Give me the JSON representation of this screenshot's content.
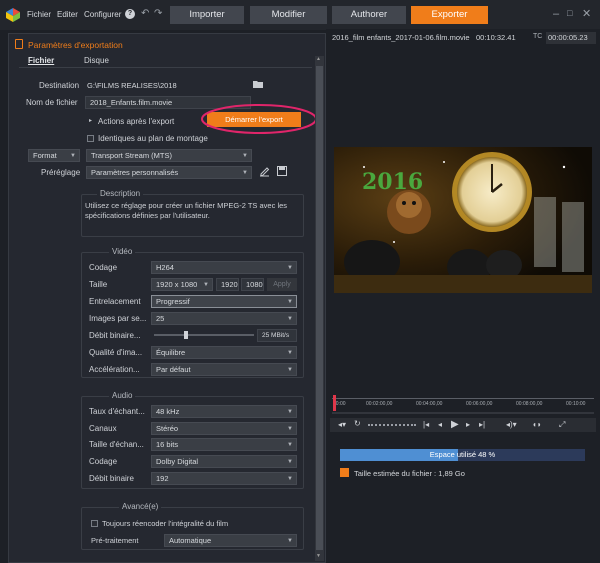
{
  "menu": {
    "file": "Fichier",
    "edit": "Editer",
    "configure": "Configurer",
    "help_icon": "?"
  },
  "main_tabs": {
    "import": "Importer",
    "modify": "Modifier",
    "author": "Authorer",
    "export": "Exporter"
  },
  "panel_title": "Paramètres d'exportation",
  "sub_tabs": {
    "file": "Fichier",
    "disc": "Disque"
  },
  "destination": {
    "label": "Destination",
    "value": "G:\\FILMS REALISES\\2018"
  },
  "filename": {
    "label": "Nom de fichier",
    "value": "2018_Enfants.film.movie"
  },
  "actions_after": "Actions après l'export",
  "start_export": "Démarrer l'export",
  "same_as_timeline": "Identiques au plan de montage",
  "format": {
    "label": "Format",
    "value": "Transport Stream (MTS)"
  },
  "preset": {
    "label": "Préréglage",
    "value": "Paramètres personnalisés"
  },
  "description": {
    "title": "Description",
    "text": "Utilisez ce réglage pour créer un fichier MPEG-2 TS avec les spécifications définies par l'utilisateur."
  },
  "video": {
    "title": "Vidéo",
    "codec": {
      "label": "Codage",
      "value": "H264"
    },
    "size": {
      "label": "Taille",
      "value": "1920 x 1080",
      "width": "1920",
      "height": "1080",
      "apply": "Apply"
    },
    "interlace": {
      "label": "Entrelacement",
      "value": "Progressif"
    },
    "fps": {
      "label": "Images par se...",
      "value": "25"
    },
    "bitrate": {
      "label": "Débit binaire...",
      "value": "25 MBit/s",
      "level": 0.3
    },
    "quality": {
      "label": "Qualité d'ima...",
      "value": "Équilibre"
    },
    "accel": {
      "label": "Accélération...",
      "value": "Par défaut"
    }
  },
  "audio": {
    "title": "Audio",
    "samplerate": {
      "label": "Taux d'échant...",
      "value": "48 kHz"
    },
    "channels": {
      "label": "Canaux",
      "value": "Stéréo"
    },
    "samplesize": {
      "label": "Taille d'échan...",
      "value": "16 bits"
    },
    "codec": {
      "label": "Codage",
      "value": "Dolby Digital"
    },
    "bitrate": {
      "label": "Débit binaire",
      "value": "192"
    }
  },
  "advanced": {
    "title": "Avancé(e)",
    "reencode": "Toujours réencoder l'intégralité du film",
    "preprocess": {
      "label": "Pré-traitement",
      "value": "Automatique"
    }
  },
  "preview": {
    "filename": "2016_film enfants_2017-01-06.film.movie",
    "duration": "00:10:32.41",
    "tc_label": "TC",
    "tc": "00:00:05.23",
    "badge": "2016"
  },
  "timeline": {
    "ticks": [
      "00:00",
      "00:02:00,00",
      "00:04:00,00",
      "00:06:00,00",
      "00:08:00,00",
      "00:10:00"
    ]
  },
  "space": {
    "label": "Espace utilisé 48 %",
    "fraction": 0.48
  },
  "estimated_size": "Taille estimée du fichier : 1,89 Go",
  "colors": {
    "accent": "#f07d1a",
    "highlight_ellipse": "#e0256a",
    "space_bar": "#4f8fd3",
    "space_track": "#2c3a5a"
  }
}
